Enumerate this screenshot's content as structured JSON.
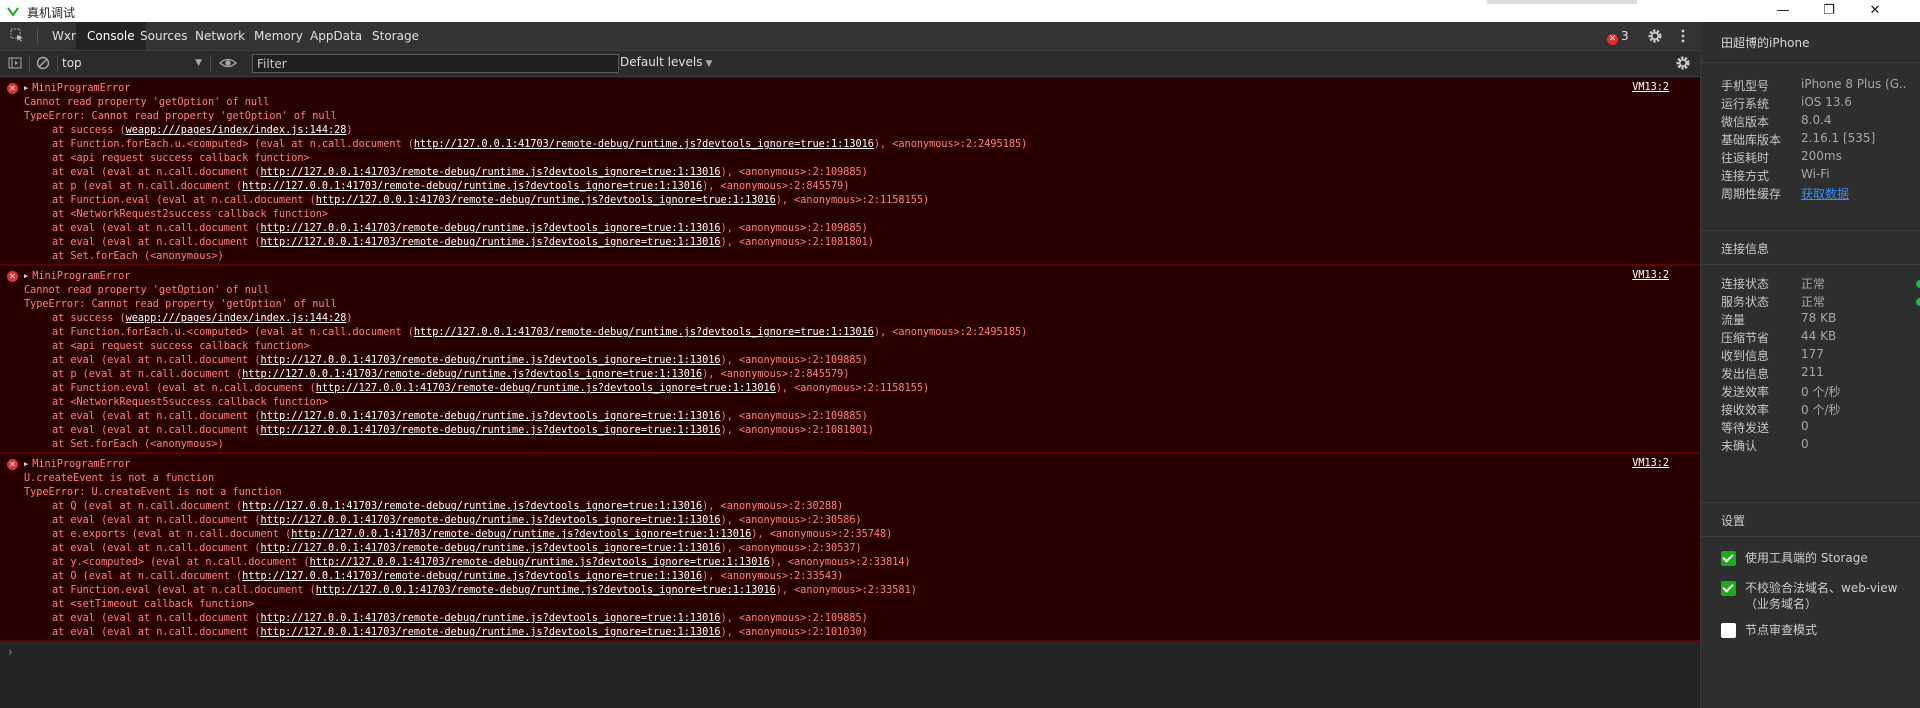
{
  "window": {
    "title": "真机调试"
  },
  "tabs": [
    "Wxml",
    "Console",
    "Sources",
    "Network",
    "Memory",
    "AppData",
    "Storage"
  ],
  "active_tab": "Console",
  "error_count": "3",
  "toolbar": {
    "context": "top",
    "filter_placeholder": "Filter",
    "levels": "Default levels"
  },
  "messages": [
    {
      "type": "error",
      "source": "VM13:2",
      "lines": [
        {
          "kind": "head",
          "text": "MiniProgramError"
        },
        {
          "kind": "text",
          "text": "Cannot read property 'getOption' of null"
        },
        {
          "kind": "text",
          "text": "TypeError: Cannot read property 'getOption' of null"
        },
        {
          "kind": "frame",
          "pre": "at success (",
          "link": "weapp:///pages/index/index.js:144:28",
          "post": ")"
        },
        {
          "kind": "frame",
          "pre": "at Function.forEach.u.<computed> (eval at n.call.document (",
          "link": "http://127.0.0.1:41703/remote-debug/runtime.js?devtools_ignore=true:1:13016",
          "post": "), <anonymous>:2:2495185)"
        },
        {
          "kind": "frame",
          "pre": "at <api request success callback function>",
          "link": "",
          "post": ""
        },
        {
          "kind": "frame",
          "pre": "at eval (eval at n.call.document (",
          "link": "http://127.0.0.1:41703/remote-debug/runtime.js?devtools_ignore=true:1:13016",
          "post": "), <anonymous>:2:109885)"
        },
        {
          "kind": "frame",
          "pre": "at p (eval at n.call.document (",
          "link": "http://127.0.0.1:41703/remote-debug/runtime.js?devtools_ignore=true:1:13016",
          "post": "), <anonymous>:2:845579)"
        },
        {
          "kind": "frame",
          "pre": "at Function.eval (eval at n.call.document (",
          "link": "http://127.0.0.1:41703/remote-debug/runtime.js?devtools_ignore=true:1:13016",
          "post": "), <anonymous>:2:1158155)"
        },
        {
          "kind": "frame",
          "pre": "at <NetworkRequest2success callback function>",
          "link": "",
          "post": ""
        },
        {
          "kind": "frame",
          "pre": "at eval (eval at n.call.document (",
          "link": "http://127.0.0.1:41703/remote-debug/runtime.js?devtools_ignore=true:1:13016",
          "post": "), <anonymous>:2:109885)"
        },
        {
          "kind": "frame",
          "pre": "at eval (eval at n.call.document (",
          "link": "http://127.0.0.1:41703/remote-debug/runtime.js?devtools_ignore=true:1:13016",
          "post": "), <anonymous>:2:1081801)"
        },
        {
          "kind": "frame",
          "pre": "at Set.forEach (<anonymous>)",
          "link": "",
          "post": ""
        }
      ]
    },
    {
      "type": "error",
      "source": "VM13:2",
      "lines": [
        {
          "kind": "head",
          "text": "MiniProgramError"
        },
        {
          "kind": "text",
          "text": "Cannot read property 'getOption' of null"
        },
        {
          "kind": "text",
          "text": "TypeError: Cannot read property 'getOption' of null"
        },
        {
          "kind": "frame",
          "pre": "at success (",
          "link": "weapp:///pages/index/index.js:144:28",
          "post": ")"
        },
        {
          "kind": "frame",
          "pre": "at Function.forEach.u.<computed> (eval at n.call.document (",
          "link": "http://127.0.0.1:41703/remote-debug/runtime.js?devtools_ignore=true:1:13016",
          "post": "), <anonymous>:2:2495185)"
        },
        {
          "kind": "frame",
          "pre": "at <api request success callback function>",
          "link": "",
          "post": ""
        },
        {
          "kind": "frame",
          "pre": "at eval (eval at n.call.document (",
          "link": "http://127.0.0.1:41703/remote-debug/runtime.js?devtools_ignore=true:1:13016",
          "post": "), <anonymous>:2:109885)"
        },
        {
          "kind": "frame",
          "pre": "at p (eval at n.call.document (",
          "link": "http://127.0.0.1:41703/remote-debug/runtime.js?devtools_ignore=true:1:13016",
          "post": "), <anonymous>:2:845579)"
        },
        {
          "kind": "frame",
          "pre": "at Function.eval (eval at n.call.document (",
          "link": "http://127.0.0.1:41703/remote-debug/runtime.js?devtools_ignore=true:1:13016",
          "post": "), <anonymous>:2:1158155)"
        },
        {
          "kind": "frame",
          "pre": "at <NetworkRequest5success callback function>",
          "link": "",
          "post": ""
        },
        {
          "kind": "frame",
          "pre": "at eval (eval at n.call.document (",
          "link": "http://127.0.0.1:41703/remote-debug/runtime.js?devtools_ignore=true:1:13016",
          "post": "), <anonymous>:2:109885)"
        },
        {
          "kind": "frame",
          "pre": "at eval (eval at n.call.document (",
          "link": "http://127.0.0.1:41703/remote-debug/runtime.js?devtools_ignore=true:1:13016",
          "post": "), <anonymous>:2:1081801)"
        },
        {
          "kind": "frame",
          "pre": "at Set.forEach (<anonymous>)",
          "link": "",
          "post": ""
        }
      ]
    },
    {
      "type": "error",
      "source": "VM13:2",
      "lines": [
        {
          "kind": "head",
          "text": "MiniProgramError"
        },
        {
          "kind": "text",
          "text": "U.createEvent is not a function"
        },
        {
          "kind": "text",
          "text": "TypeError: U.createEvent is not a function"
        },
        {
          "kind": "frame",
          "pre": "at Q (eval at n.call.document (",
          "link": "http://127.0.0.1:41703/remote-debug/runtime.js?devtools_ignore=true:1:13016",
          "post": "), <anonymous>:2:30288)"
        },
        {
          "kind": "frame",
          "pre": "at eval (eval at n.call.document (",
          "link": "http://127.0.0.1:41703/remote-debug/runtime.js?devtools_ignore=true:1:13016",
          "post": "), <anonymous>:2:30586)"
        },
        {
          "kind": "frame",
          "pre": "at e.exports (eval at n.call.document (",
          "link": "http://127.0.0.1:41703/remote-debug/runtime.js?devtools_ignore=true:1:13016",
          "post": "), <anonymous>:2:35748)"
        },
        {
          "kind": "frame",
          "pre": "at eval (eval at n.call.document (",
          "link": "http://127.0.0.1:41703/remote-debug/runtime.js?devtools_ignore=true:1:13016",
          "post": "), <anonymous>:2:30537)"
        },
        {
          "kind": "frame",
          "pre": "at y.<computed> (eval at n.call.document (",
          "link": "http://127.0.0.1:41703/remote-debug/runtime.js?devtools_ignore=true:1:13016",
          "post": "), <anonymous>:2:33814)"
        },
        {
          "kind": "frame",
          "pre": "at O (eval at n.call.document (",
          "link": "http://127.0.0.1:41703/remote-debug/runtime.js?devtools_ignore=true:1:13016",
          "post": "), <anonymous>:2:33543)"
        },
        {
          "kind": "frame",
          "pre": "at Function.eval (eval at n.call.document (",
          "link": "http://127.0.0.1:41703/remote-debug/runtime.js?devtools_ignore=true:1:13016",
          "post": "), <anonymous>:2:33581)"
        },
        {
          "kind": "frame",
          "pre": "at <setTimeout callback function>",
          "link": "",
          "post": ""
        },
        {
          "kind": "frame",
          "pre": "at eval (eval at n.call.document (",
          "link": "http://127.0.0.1:41703/remote-debug/runtime.js?devtools_ignore=true:1:13016",
          "post": "), <anonymous>:2:109885)"
        },
        {
          "kind": "frame",
          "pre": "at eval (eval at n.call.document (",
          "link": "http://127.0.0.1:41703/remote-debug/runtime.js?devtools_ignore=true:1:13016",
          "post": "), <anonymous>:2:101030)"
        }
      ]
    }
  ],
  "panel": {
    "device_title": "田超博的iPhone",
    "info": [
      {
        "key": "手机型号",
        "value": "iPhone 8 Plus (G..."
      },
      {
        "key": "运行系统",
        "value": "iOS 13.6"
      },
      {
        "key": "微信版本",
        "value": "8.0.4"
      },
      {
        "key": "基础库版本",
        "value": "2.16.1 [535]"
      },
      {
        "key": "往返耗时",
        "value": "200ms"
      },
      {
        "key": "连接方式",
        "value": "Wi-Fi"
      },
      {
        "key": "周期性缓存",
        "value": "获取数据",
        "link": true
      }
    ],
    "connection_title": "连接信息",
    "connection": [
      {
        "key": "连接状态",
        "value": "正常",
        "status": true
      },
      {
        "key": "服务状态",
        "value": "正常",
        "status": true
      },
      {
        "key": "流量",
        "value": "78 KB"
      },
      {
        "key": "压缩节省",
        "value": "44 KB"
      },
      {
        "key": "收到信息",
        "value": "177"
      },
      {
        "key": "发出信息",
        "value": "211"
      },
      {
        "key": "发送效率",
        "value": "0 个/秒"
      },
      {
        "key": "接收效率",
        "value": "0 个/秒"
      },
      {
        "key": "等待发送",
        "value": "0"
      },
      {
        "key": "未确认",
        "value": "0"
      }
    ],
    "settings_title": "设置",
    "settings": [
      {
        "label": "使用工具端的 Storage",
        "checked": true
      },
      {
        "label": "不校验合法域名、web-view（业务域名）",
        "checked": true
      },
      {
        "label": "节点审查模式",
        "checked": false
      }
    ]
  },
  "colors": {
    "error_bg": "#290000",
    "error_text": "#ff8080",
    "status_ok": "#1db954",
    "check_on": "#1aad19"
  }
}
